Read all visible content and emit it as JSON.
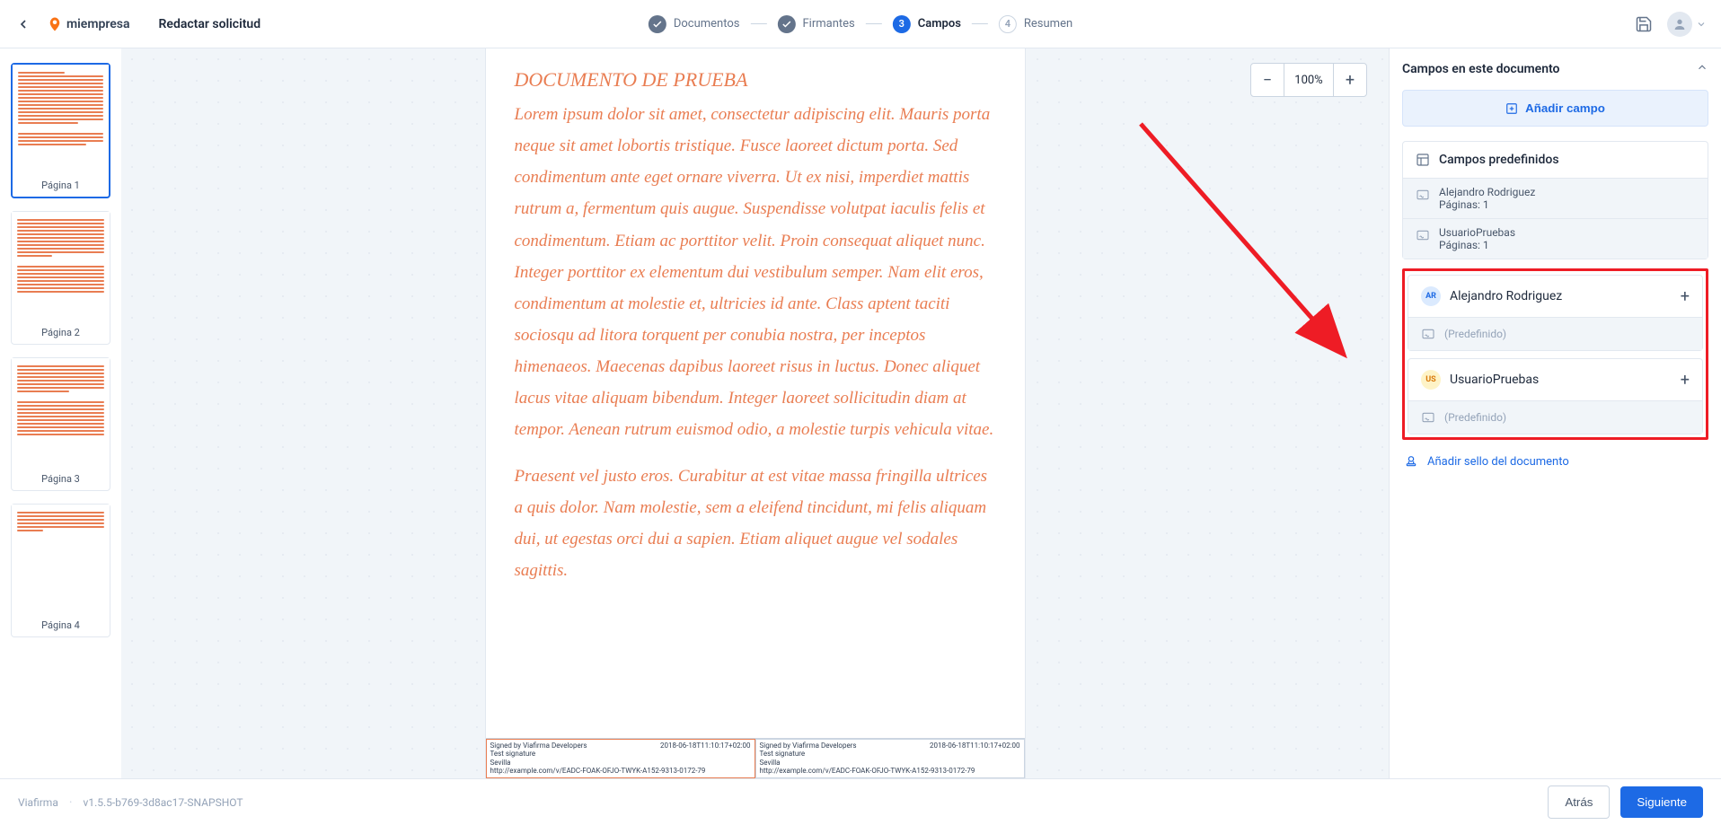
{
  "header": {
    "logo_text": "miempresa",
    "title": "Redactar solicitud"
  },
  "stepper": {
    "step1": "Documentos",
    "step2": "Firmantes",
    "step3_num": "3",
    "step3": "Campos",
    "step4_num": "4",
    "step4": "Resumen"
  },
  "thumbs": {
    "labels": [
      "Página 1",
      "Página 2",
      "Página 3",
      "Página 4"
    ]
  },
  "zoom": {
    "minus": "−",
    "value": "100%",
    "plus": "+"
  },
  "document": {
    "title": "DOCUMENTO DE PRUEBA",
    "p1": "Lorem ipsum dolor sit amet, consectetur adipiscing elit. Mauris porta neque sit amet lobortis tristique. Fusce laoreet dictum porta. Sed condimentum ante eget ornare viverra. Ut ex nisi, imperdiet mattis rutrum a, fermentum quis augue. Suspendisse volutpat iaculis felis et condimentum. Etiam ac porttitor velit. Proin consequat aliquet nunc. Integer porttitor ex elementum dui vestibulum semper. Nam elit eros, condimentum at molestie et, ultricies id ante. Class aptent taciti sociosqu ad litora torquent per conubia nostra, per inceptos himenaeos. Maecenas dapibus laoreet risus in luctus. Donec aliquet lacus vitae aliquam bibendum. Integer laoreet sollicitudin diam at tempor. Aenean rutrum euismod odio, a molestie turpis vehicula vitae.",
    "p2": "Praesent vel justo eros. Curabitur at est vitae massa fringilla ultrices a quis dolor. Nam molestie, sem a eleifend tincidunt, mi felis aliquam dui, ut egestas orci dui a sapien. Etiam aliquet augue vel sodales sagittis.",
    "sig_signed_by": "Signed by Viafirma Developers",
    "sig_ts": "2018-06-18T11:10:17+02:00",
    "sig_type": "Test signature",
    "sig_loc": "Sevilla",
    "sig_url": "http://example.com/v/EADC-FOAK-OFJO-TWYK-A152-9313-0172-79"
  },
  "panel": {
    "title": "Campos en este documento",
    "add_field": "Añadir campo",
    "predefined_header": "Campos predefinidos",
    "users": [
      {
        "name": "Alejandro Rodriguez",
        "pages": "Páginas: 1"
      },
      {
        "name": "UsuarioPruebas",
        "pages": "Páginas: 1"
      }
    ],
    "signer1": {
      "initials": "AR",
      "name": "Alejandro Rodriguez",
      "predefined": "(Predefinido)"
    },
    "signer2": {
      "initials": "US",
      "name": "UsuarioPruebas",
      "predefined": "(Predefinido)"
    },
    "add_seal": "Añadir sello del documento"
  },
  "footer": {
    "brand": "Viafirma",
    "version": "v1.5.5-b769-3d8ac17-SNAPSHOT",
    "back": "Atrás",
    "next": "Siguiente"
  }
}
